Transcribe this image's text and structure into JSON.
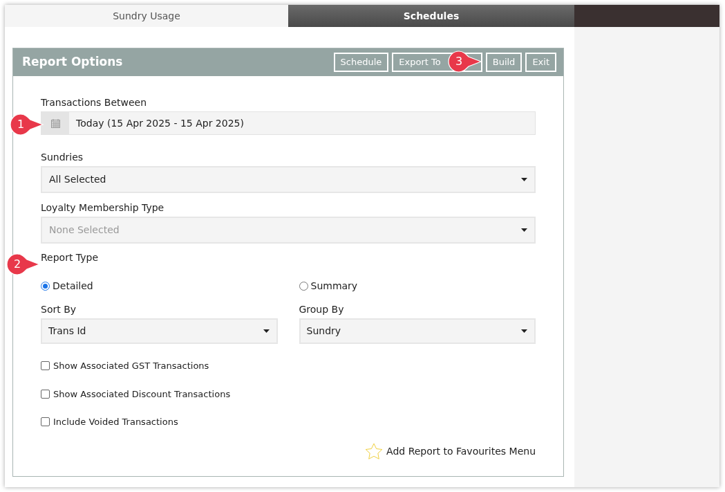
{
  "tabs": [
    {
      "label": "Sundry Usage",
      "selected": false
    },
    {
      "label": "Schedules",
      "selected": true
    }
  ],
  "panel": {
    "title": "Report Options",
    "buttons": [
      "Schedule",
      "Export To",
      "Build",
      "Exit"
    ]
  },
  "date_range": {
    "label": "Transactions Between",
    "value": "Today (15 Apr 2025 - 15 Apr 2025)"
  },
  "selects": [
    {
      "label": "Sundries",
      "value": "All Selected",
      "disabled": false
    },
    {
      "label": "Loyalty Membership Type",
      "value": "None Selected",
      "disabled": true
    }
  ],
  "report_type": {
    "label": "Report Type",
    "options": [
      {
        "label": "Detailed",
        "selected": true
      },
      {
        "label": "Summary",
        "selected": false
      }
    ]
  },
  "sort_group": [
    {
      "label": "Sort By",
      "value": "Trans Id"
    },
    {
      "label": "Group By",
      "value": "Sundry"
    }
  ],
  "checkboxes": [
    {
      "label": "Show Associated GST Transactions",
      "checked": false
    },
    {
      "label": "Show Associated Discount Transactions",
      "checked": false
    },
    {
      "label": "Include Voided Transactions",
      "checked": false
    }
  ],
  "favourites_link": "Add Report to Favourites Menu",
  "callouts": [
    "1",
    "2",
    "3"
  ]
}
